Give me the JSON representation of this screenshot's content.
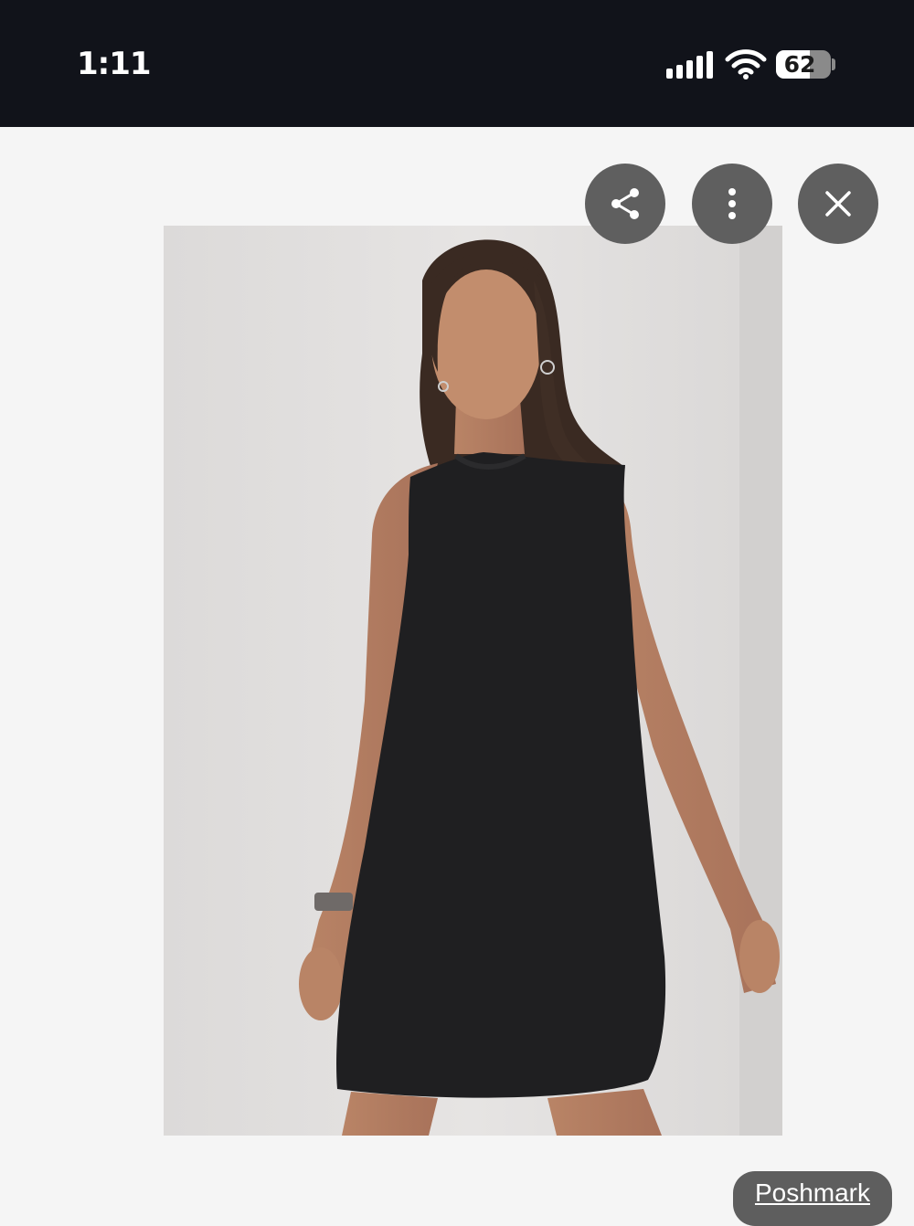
{
  "status_bar": {
    "time": "1:11",
    "battery_percent": "62",
    "battery_level": 0.62,
    "signal_bars": 5,
    "signal_icon": "cellular-signal-icon",
    "wifi_icon": "wifi-icon",
    "background_color": "#11131a"
  },
  "viewer": {
    "share_icon": "share-icon",
    "more_icon": "more-vertical-icon",
    "close_icon": "close-icon",
    "button_color": "#5f5f5f"
  },
  "image": {
    "subject": "woman-in-black-sleeveless-dress-photo"
  },
  "source": {
    "label": "Poshmark"
  }
}
